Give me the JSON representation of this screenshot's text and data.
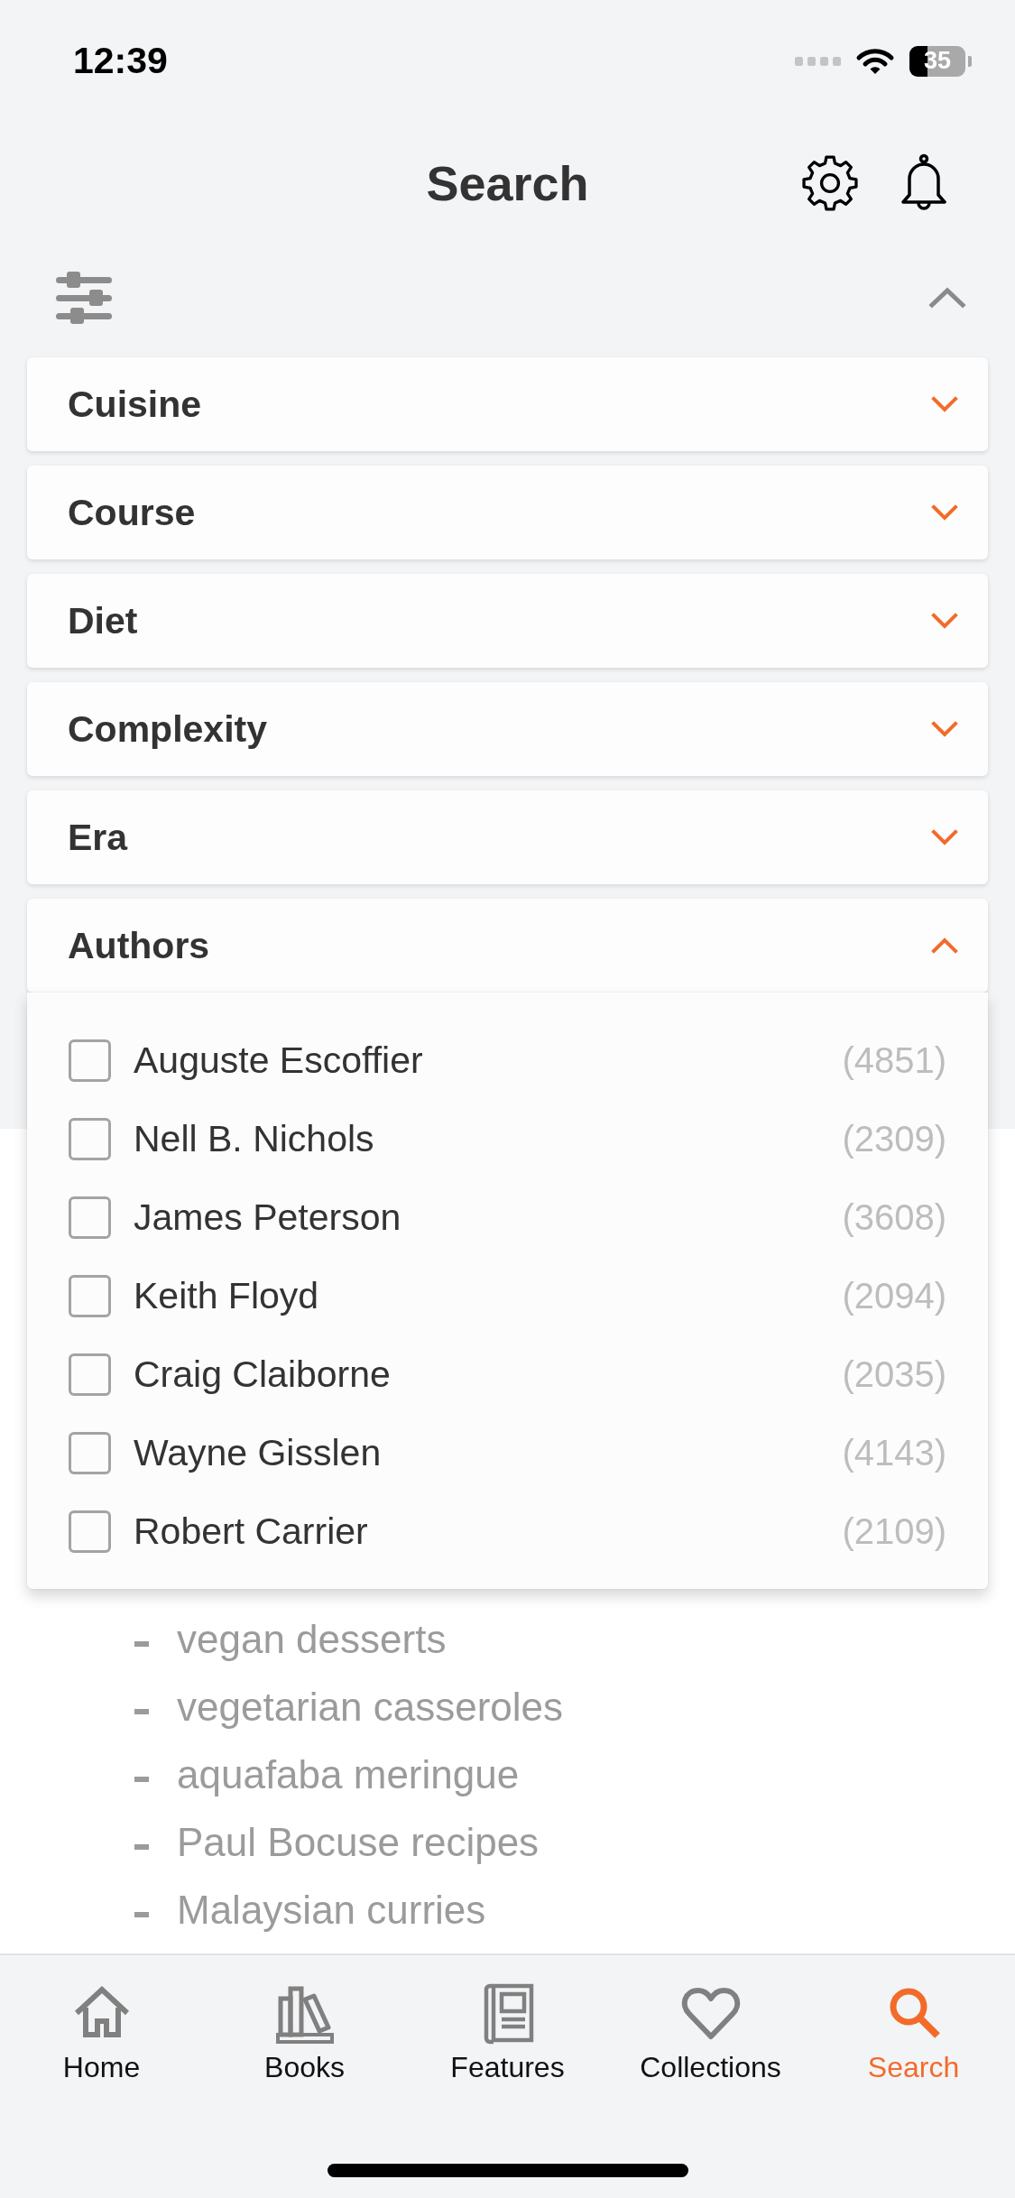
{
  "status_bar": {
    "time": "12:39",
    "battery": "35"
  },
  "header": {
    "title": "Search"
  },
  "filter_panel": {
    "expanded": true,
    "sections": [
      {
        "label": "Cuisine",
        "expanded": false
      },
      {
        "label": "Course",
        "expanded": false
      },
      {
        "label": "Diet",
        "expanded": false
      },
      {
        "label": "Complexity",
        "expanded": false
      },
      {
        "label": "Era",
        "expanded": false
      },
      {
        "label": "Authors",
        "expanded": true,
        "options": [
          {
            "name": "Auguste Escoffier",
            "count": "(4851)",
            "checked": false
          },
          {
            "name": "Nell B. Nichols",
            "count": "(2309)",
            "checked": false
          },
          {
            "name": "James Peterson",
            "count": "(3608)",
            "checked": false
          },
          {
            "name": "Keith Floyd",
            "count": "(2094)",
            "checked": false
          },
          {
            "name": "Craig Claiborne",
            "count": "(2035)",
            "checked": false
          },
          {
            "name": "Wayne Gisslen",
            "count": "(4143)",
            "checked": false
          },
          {
            "name": "Robert Carrier",
            "count": "(2109)",
            "checked": false
          }
        ]
      }
    ]
  },
  "suggestions": [
    "vegan desserts",
    "vegetarian casseroles",
    "aquafaba meringue",
    "Paul Bocuse recipes",
    "Malaysian curries"
  ],
  "tabs": [
    {
      "label": "Home",
      "selected": false
    },
    {
      "label": "Books",
      "selected": false
    },
    {
      "label": "Features",
      "selected": false
    },
    {
      "label": "Collections",
      "selected": false
    },
    {
      "label": "Search",
      "selected": true
    }
  ]
}
